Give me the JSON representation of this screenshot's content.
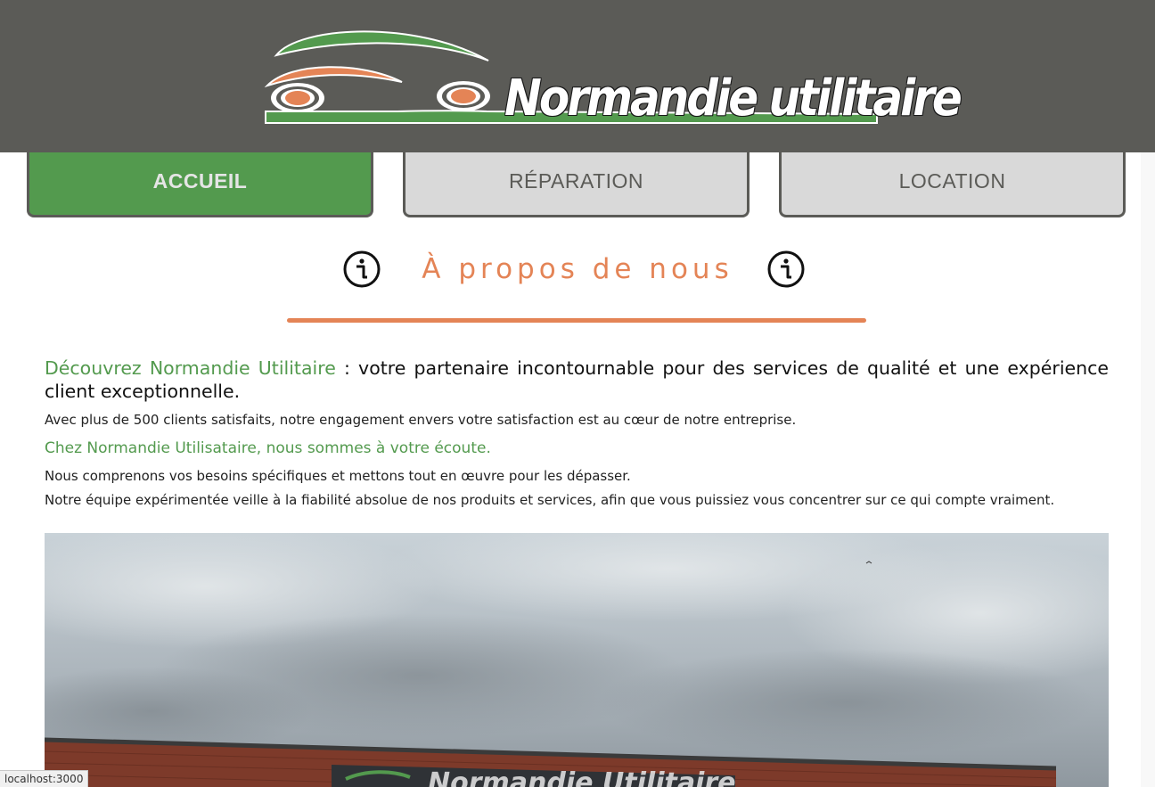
{
  "header": {
    "logo_text": "Normandie utilitaire",
    "colors": {
      "background": "#5b5b57",
      "green": "#539a4e",
      "orange": "#e48456"
    }
  },
  "nav": {
    "items": [
      {
        "label": "ACCUEIL",
        "active": true
      },
      {
        "label": "RÉPARATION",
        "active": false
      },
      {
        "label": "LOCATION",
        "active": false
      }
    ]
  },
  "about": {
    "title": "À propos de nous",
    "icon": "info-circle-icon",
    "intro_highlight": "Découvrez Normandie Utilitaire",
    "intro_rest": " : votre partenaire incontournable pour des services de qualité et une expérience client exceptionnelle.",
    "clients_text": "Avec plus de 500 clients satisfaits, notre engagement envers votre satisfaction est au cœur de notre entreprise.",
    "subheading": "Chez Normandie Utilisataire, nous sommes à votre écoute.",
    "paragraph_1": "Nous comprenons vos besoins spécifiques et mettons tout en œuvre pour les dépasser.",
    "paragraph_2": "Notre équipe expérimentée veille à la fiabilité absolue de nos produits et services, afin que vous puissiez vous concentrer sur ce qui compte vraiment."
  },
  "status_bar": {
    "url": "localhost:3000"
  }
}
